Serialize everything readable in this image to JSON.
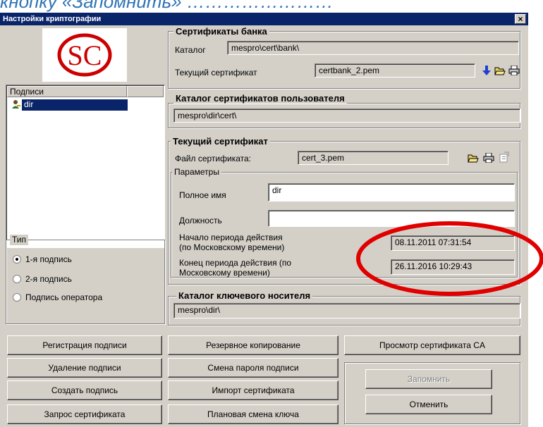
{
  "caption": "кнопку «Запомнить» ……………………",
  "window": {
    "title": "Настройки криптографии",
    "close_label": "×"
  },
  "logo": {
    "text": "SC",
    "color": "#cc0000"
  },
  "signatures": {
    "header": "Подписи",
    "items": [
      {
        "label": "dir",
        "selected": true,
        "icon": "user-key-icon"
      }
    ]
  },
  "type_group": {
    "title": "Тип",
    "options": [
      {
        "label": "1-я подпись",
        "selected": true
      },
      {
        "label": "2-я подпись",
        "selected": false
      },
      {
        "label": "Подпись оператора",
        "selected": false
      }
    ]
  },
  "bank_certs": {
    "title": "Сертификаты банка",
    "catalog_label": "Каталог",
    "catalog_value": "mespro\\cert\\bank\\",
    "current_label": "Текущий сертификат",
    "current_value": "certbank_2.pem",
    "icons": [
      "download-arrow-icon",
      "open-folder-icon",
      "print-icon"
    ]
  },
  "user_catalog": {
    "title": "Каталог сертификатов пользователя",
    "value": "mespro\\dir\\cert\\"
  },
  "current_cert": {
    "title": "Текущий сертификат",
    "file_label": "Файл сертификата:",
    "file_value": "cert_3.pem",
    "icons": [
      "open-folder-icon",
      "print-icon",
      "properties-icon"
    ],
    "params": {
      "title": "Параметры",
      "full_name_label": "Полное имя",
      "full_name_value": "dir",
      "position_label": "Должность",
      "position_value": "",
      "start_label_1": "Начало периода действия",
      "start_label_2": "(по Московскому времени)",
      "start_value": "08.11.2011 07:31:54",
      "end_label_1": "Конец периода действия (по",
      "end_label_2": "Московскому времени)",
      "end_value": "26.11.2016 10:29:43"
    }
  },
  "key_catalog": {
    "title": "Каталог ключевого носителя",
    "value": "mespro\\dir\\"
  },
  "buttons": {
    "register": "Регистрация подписи",
    "delete": "Удаление подписи",
    "create": "Создать подпись",
    "request": "Запрос сертификата",
    "backup": "Резервное копирование",
    "change_password": "Смена пароля подписи",
    "import": "Импорт сертификата",
    "planned_change": "Плановая смена ключа",
    "view_ca": "Просмотр сертификата CA",
    "remember": "Запомнить",
    "cancel": "Отменить"
  },
  "annotation": {
    "color": "#e00000"
  },
  "colors": {
    "titlebar": "#0a246a",
    "face": "#d4d0c8",
    "selection": "#0a246a",
    "arrow": "#1f3fd0"
  }
}
